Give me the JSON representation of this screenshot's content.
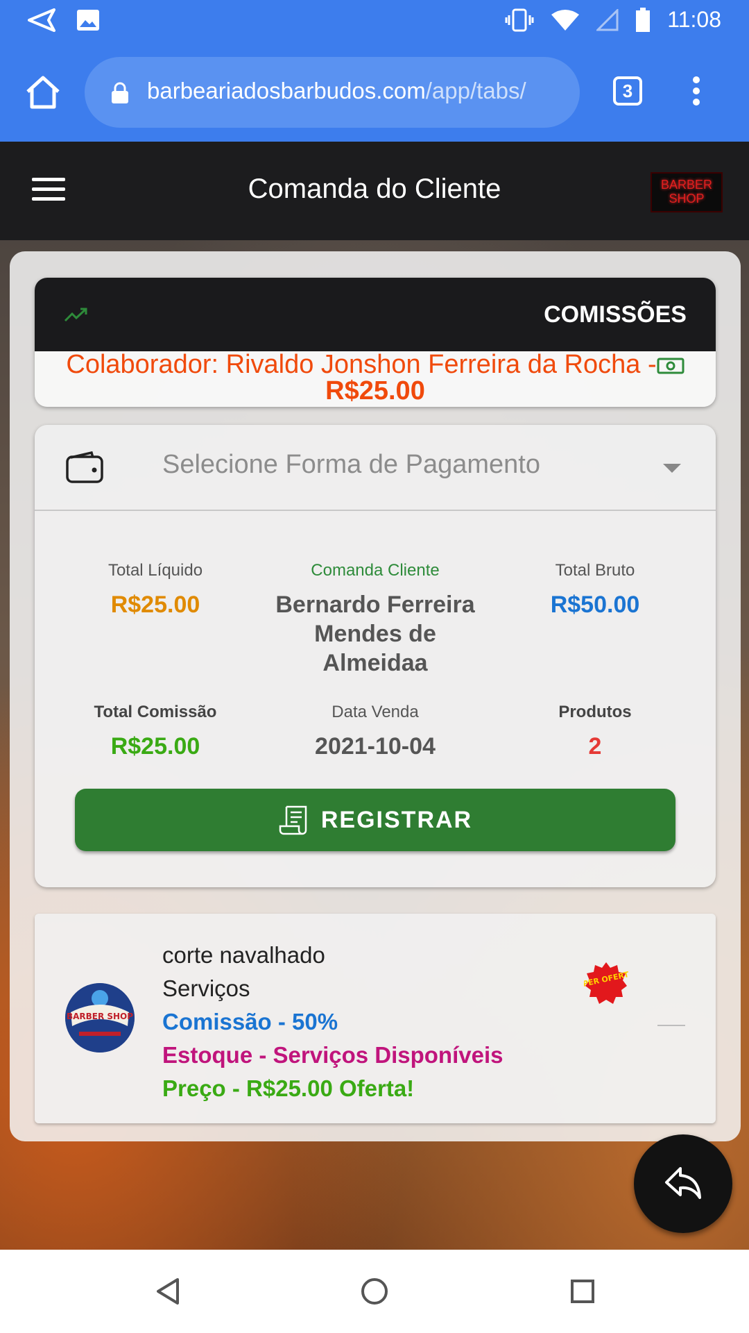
{
  "status_bar": {
    "time": "11:08"
  },
  "browser": {
    "url_domain": "barbeariadosbarbudos.com",
    "url_path": "/app/tabs/",
    "tab_count": "3"
  },
  "header": {
    "title": "Comanda do Cliente",
    "logo_text": "BARBER SHOP"
  },
  "commissions": {
    "title": "COMISSÕES",
    "collaborator_line": "Colaborador: Rivaldo Jonshon Ferreira da Rocha -",
    "value": "R$25.00"
  },
  "payment": {
    "placeholder": "Selecione Forma de Pagamento"
  },
  "summary": {
    "total_liquido_label": "Total Líquido",
    "total_liquido_value": "R$25.00",
    "comanda_label": "Comanda Cliente",
    "comanda_name": "Bernardo Ferreira Mendes de Almeidaa",
    "total_bruto_label": "Total Bruto",
    "total_bruto_value": "R$50.00",
    "total_comissao_label": "Total Comissão",
    "total_comissao_value": "R$25.00",
    "data_venda_label": "Data Venda",
    "data_venda_value": "2021-10-04",
    "produtos_label": "Produtos",
    "produtos_value": "2"
  },
  "register_button": "REGISTRAR",
  "item": {
    "name": "corte navalhado",
    "category": "Serviços",
    "commission": "Comissão - 50%",
    "stock": "Estoque - Serviços Disponíveis",
    "price": "Preço - R$25.00 Oferta!",
    "badge_text": "SUPER OFERTAS",
    "avatar_text": "BARBER SHOP"
  },
  "colors": {
    "browser_blue": "#3d7ded",
    "orange": "#f04a0c",
    "amber": "#e08a00",
    "blue": "#1a74d2",
    "green": "#2f7d32",
    "lime": "#3aaa14",
    "magenta": "#c0147c",
    "red": "#e53935"
  },
  "icons": [
    "send-icon",
    "image-icon",
    "vibrate-icon",
    "wifi-icon",
    "signal-icon",
    "battery-icon",
    "home-icon",
    "lock-icon",
    "tabs-icon",
    "more-icon",
    "menu-icon",
    "trend-icon",
    "money-icon",
    "wallet-icon",
    "caret-down-icon",
    "receipt-icon",
    "reply-icon",
    "nav-back-icon",
    "nav-home-icon",
    "nav-recent-icon"
  ]
}
